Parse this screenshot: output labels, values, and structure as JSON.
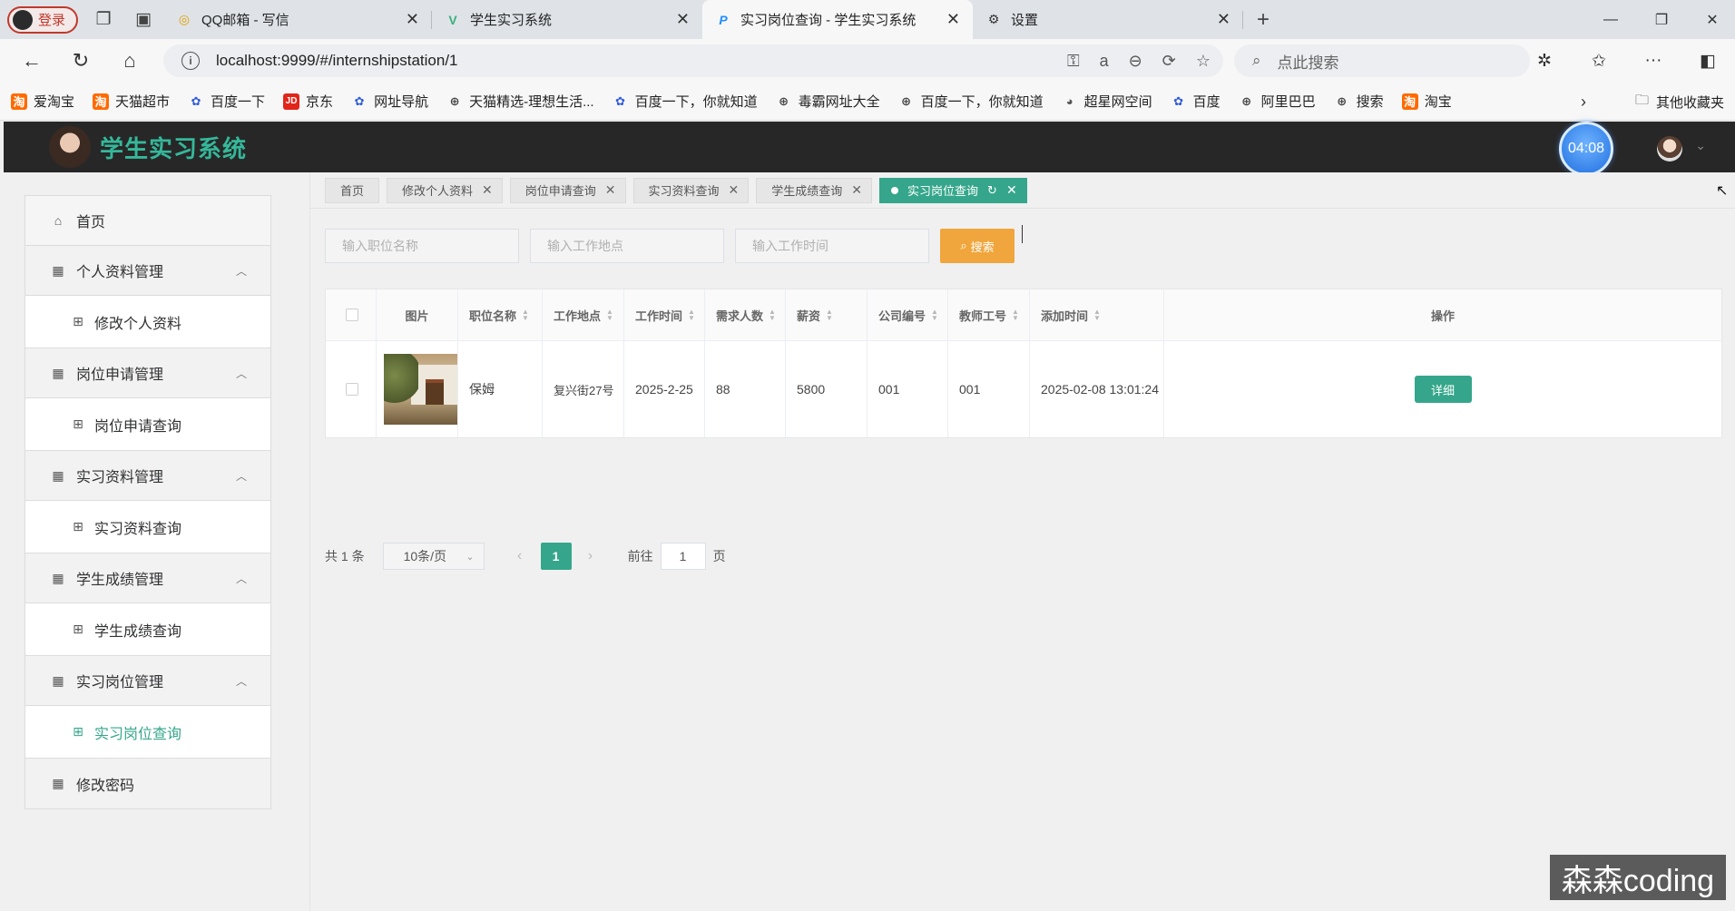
{
  "browser": {
    "login_label": "登录",
    "tabs": [
      {
        "title": "QQ邮箱 - 写信",
        "icon": "qq-mail-icon"
      },
      {
        "title": "学生实习系统",
        "icon": "vue-icon"
      },
      {
        "title": "实习岗位查询 - 学生实习系统",
        "icon": "p-icon",
        "active": true
      },
      {
        "title": "设置",
        "icon": "gear-icon"
      }
    ],
    "url": "localhost:9999/#/internshipstation/1",
    "search_placeholder": "点此搜索",
    "bookmarks": [
      "爱淘宝",
      "天猫超市",
      "百度一下",
      "京东",
      "网址导航",
      "天猫精选-理想生活...",
      "百度一下，你就知道",
      "毒霸网址大全",
      "百度一下，你就知道",
      "超星网空间",
      "百度",
      "阿里巴巴",
      "搜索",
      "淘宝"
    ],
    "other_bookmarks": "其他收藏夹"
  },
  "app": {
    "title": "学生实习系统",
    "timer": "04:08"
  },
  "sidebar": {
    "home": "首页",
    "groups": [
      {
        "label": "个人资料管理",
        "sub": "修改个人资料"
      },
      {
        "label": "岗位申请管理",
        "sub": "岗位申请查询"
      },
      {
        "label": "实习资料管理",
        "sub": "实习资料查询"
      },
      {
        "label": "学生成绩管理",
        "sub": "学生成绩查询"
      },
      {
        "label": "实习岗位管理",
        "sub": "实习岗位查询"
      }
    ],
    "change_password": "修改密码"
  },
  "tags": [
    "首页",
    "修改个人资料",
    "岗位申请查询",
    "实习资料查询",
    "学生成绩查询",
    "实习岗位查询"
  ],
  "filters": {
    "name_placeholder": "输入职位名称",
    "location_placeholder": "输入工作地点",
    "time_placeholder": "输入工作时间",
    "search_label": "搜索"
  },
  "table": {
    "headers": [
      "图片",
      "职位名称",
      "工作地点",
      "工作时间",
      "需求人数",
      "薪资",
      "公司编号",
      "教师工号",
      "添加时间",
      "操作"
    ],
    "rows": [
      {
        "title": "保姆",
        "location": "复兴街27号",
        "time": "2025-2-25",
        "count": "88",
        "salary": "5800",
        "company": "001",
        "teacher": "001",
        "added": "2025-02-08 13:01:24",
        "action": "详细"
      }
    ]
  },
  "pager": {
    "total": "共 1 条",
    "size": "10条/页",
    "current": "1",
    "goto_prefix": "前往",
    "goto_value": "1",
    "goto_suffix": "页"
  },
  "watermark": "森森coding",
  "colors": {
    "accent": "#35a68b",
    "title": "#35b89a",
    "search": "#f0a63c",
    "header_bg": "#272727"
  }
}
